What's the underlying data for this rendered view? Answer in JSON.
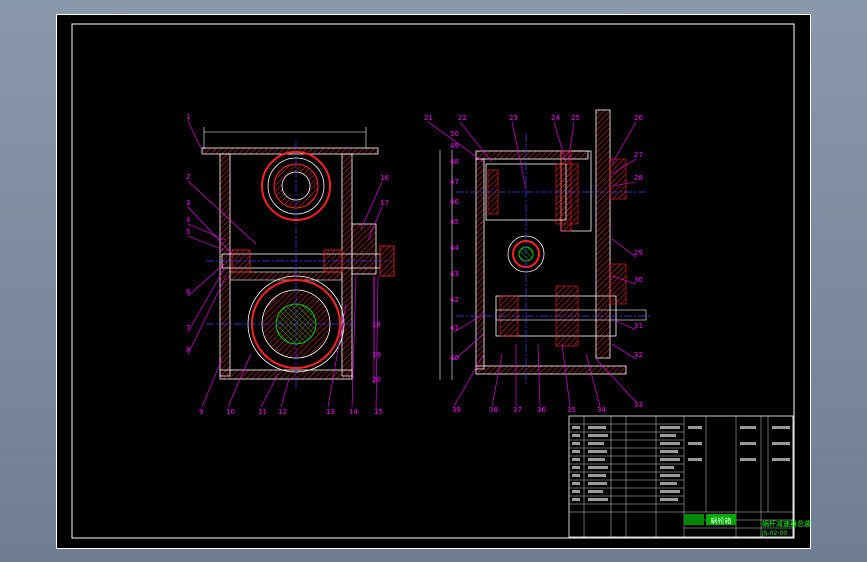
{
  "drawing": {
    "left_view_labels": [
      "1",
      "2",
      "3",
      "4",
      "5",
      "6",
      "7",
      "8",
      "9",
      "10",
      "11",
      "12",
      "13",
      "14",
      "15",
      "16",
      "17",
      "18",
      "19",
      "20"
    ],
    "right_view_labels": [
      "21",
      "22",
      "23",
      "24",
      "25",
      "26",
      "27",
      "28",
      "29",
      "30",
      "31",
      "32",
      "33",
      "34",
      "35",
      "36",
      "37",
      "38",
      "39",
      "40",
      "41",
      "42",
      "43",
      "44",
      "45",
      "46",
      "47",
      "48",
      "49",
      "50"
    ],
    "title_block": {
      "name_cell": "蜗轮箱",
      "drawing_title": "蜗杆减速器总装配图",
      "drawing_number": "JS-02-00"
    }
  },
  "colors": {
    "background": "#000000",
    "outline": "#ffffff",
    "hatch": "#ff2020",
    "leaders": "#ff00ff",
    "centerline": "#4040ff",
    "parts": "#00cc00",
    "title_text": "#00ff00"
  }
}
